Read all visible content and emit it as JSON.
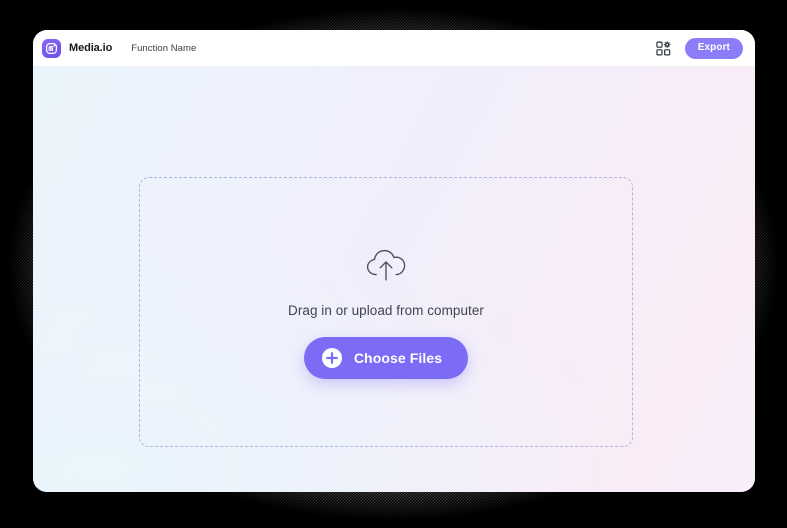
{
  "window": {
    "header": {
      "logo_icon": "media-io-logo-icon",
      "brand_name": "Media.io",
      "function_name": "Function Name",
      "apps_icon": "apps-grid-icon",
      "export_label": "Export"
    },
    "stage": {
      "dropzone": {
        "upload_icon": "cloud-upload-icon",
        "hint": "Drag in or upload from computer",
        "choose_files_label": "Choose Files",
        "plus_icon": "plus-circle-icon"
      }
    }
  },
  "colors": {
    "accent": "#7c6cf5",
    "export_button": "#8b7cf8",
    "dashed_border": "#aeb6da",
    "hint_text": "#3f4550",
    "brand_text": "#15181f",
    "stage_gradient_start": "#eaf4fb",
    "stage_gradient_end": "#f9ecf6",
    "frame": "#000000"
  }
}
